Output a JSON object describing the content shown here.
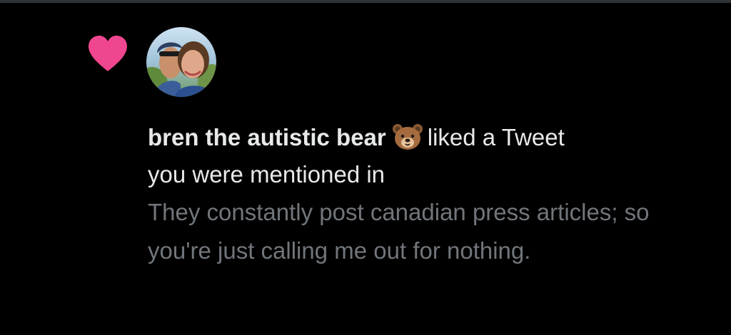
{
  "notification": {
    "type_icon": "heart-icon",
    "avatar_icon": "avatar",
    "author_name": "bren the autistic bear",
    "author_emoji": "bear-face-emoji",
    "action_part1": "liked a Tweet",
    "action_part2": "you were mentioned in",
    "tweet_preview": "They constantly post canadian press articles; so you're just calling me out for nothing."
  },
  "colors": {
    "background": "#000000",
    "heart": "#f0468f",
    "primary_text": "#e7e9ea",
    "secondary_text": "#71767b",
    "divider": "#2f3336"
  }
}
